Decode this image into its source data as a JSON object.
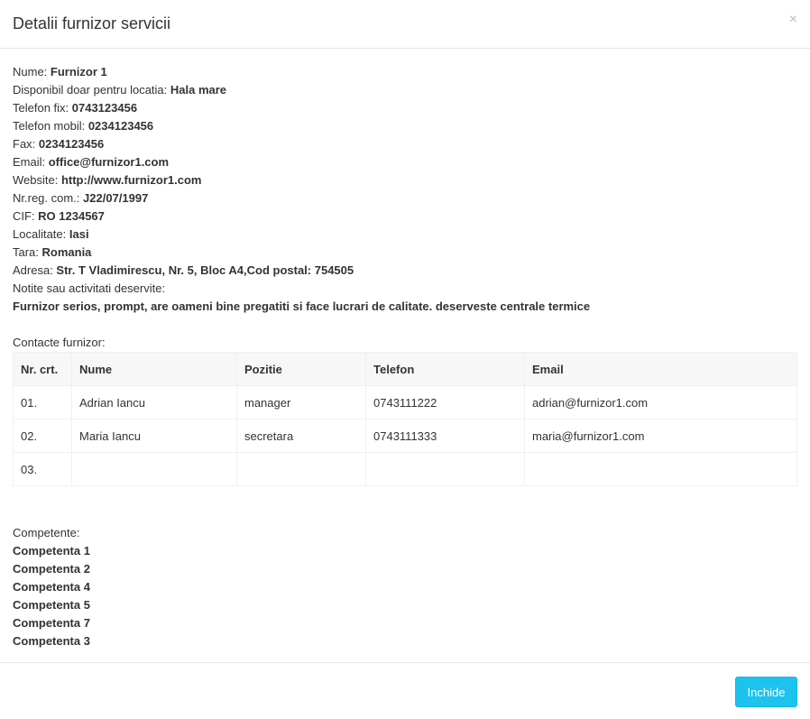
{
  "modal": {
    "title": "Detalii furnizor servicii",
    "close_glyph": "×",
    "footer_button": "Inchide"
  },
  "details": [
    {
      "label": "Nume: ",
      "value": "Furnizor 1"
    },
    {
      "label": "Disponibil doar pentru locatia: ",
      "value": "Hala mare"
    },
    {
      "label": "Telefon fix: ",
      "value": "0743123456"
    },
    {
      "label": "Telefon mobil: ",
      "value": "0234123456"
    },
    {
      "label": "Fax: ",
      "value": "0234123456"
    },
    {
      "label": "Email: ",
      "value": "office@furnizor1.com"
    },
    {
      "label": "Website: ",
      "value": "http://www.furnizor1.com"
    },
    {
      "label": "Nr.reg. com.: ",
      "value": "J22/07/1997"
    },
    {
      "label": "CIF: ",
      "value": "RO 1234567"
    },
    {
      "label": "Localitate: ",
      "value": "Iasi"
    },
    {
      "label": "Tara: ",
      "value": "Romania"
    },
    {
      "label": "Adresa: ",
      "value": "Str. T Vladimirescu, Nr. 5, Bloc A4,Cod postal: 754505"
    }
  ],
  "notes": {
    "label": "Notite sau activitati deservite:",
    "value": "Furnizor serios, prompt, are oameni bine pregatiti si face lucrari de calitate. deserveste centrale termice"
  },
  "contacts": {
    "label": "Contacte furnizor:",
    "headers": [
      "Nr. crt.",
      "Nume",
      "Pozitie",
      "Telefon",
      "Email"
    ],
    "rows": [
      [
        "01.",
        "Adrian Iancu",
        "manager",
        "0743111222",
        "adrian@furnizor1.com"
      ],
      [
        "02.",
        "Maria Iancu",
        "secretara",
        "0743111333",
        "maria@furnizor1.com"
      ],
      [
        "03.",
        "",
        "",
        "",
        ""
      ]
    ]
  },
  "competences": {
    "label": "Competente:",
    "items": [
      "Competenta 1",
      "Competenta 2",
      "Competenta 4",
      "Competenta 5",
      "Competenta 7",
      "Competenta 3"
    ]
  }
}
